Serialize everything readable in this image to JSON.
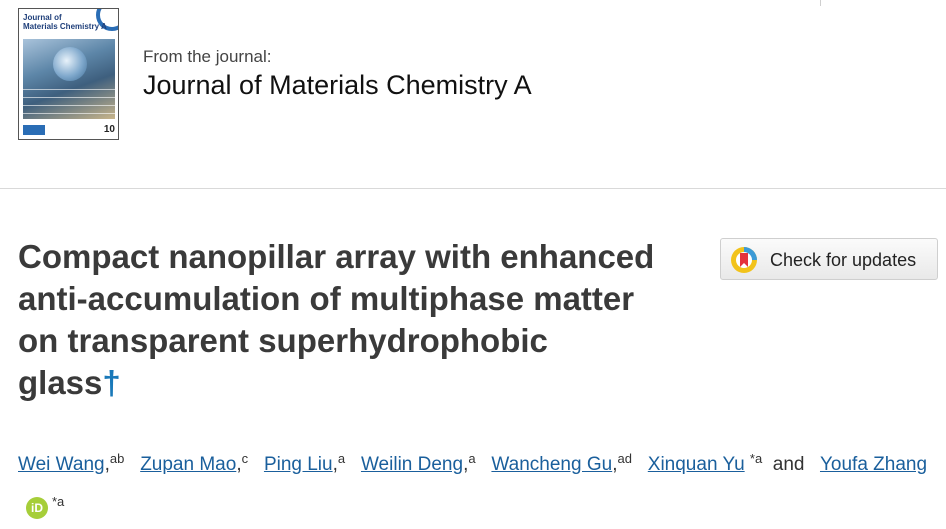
{
  "header": {
    "from_label": "From the journal:",
    "journal_name": "Journal of Materials Chemistry A",
    "cover": {
      "title_line1": "Journal of",
      "title_line2": "Materials Chemistry A",
      "badge": "10"
    }
  },
  "article": {
    "title": "Compact nanopillar array with enhanced anti-accumulation of multiphase matter on transparent superhydrophobic glass",
    "title_mark": "†",
    "updates_button_label": "Check for updates"
  },
  "authors": [
    {
      "name": "Wei Wang",
      "sup": "ab",
      "sep": ","
    },
    {
      "name": "Zupan Mao",
      "sup": "c",
      "sep": ","
    },
    {
      "name": "Ping Liu",
      "sup": "a",
      "sep": ","
    },
    {
      "name": "Weilin Deng",
      "sup": "a",
      "sep": ","
    },
    {
      "name": "Wancheng Gu",
      "sup": "ad",
      "sep": ","
    },
    {
      "name": "Xinquan Yu",
      "sup": "*a",
      "sep": ""
    },
    {
      "name": "Youfa Zhang",
      "sup": "*a",
      "sep": ""
    }
  ],
  "authors_conjunction": "and",
  "orcid_label": "iD",
  "colors": {
    "link": "#1a5f9c",
    "dagger": "#1a79b9",
    "orcid": "#a6ce39"
  }
}
